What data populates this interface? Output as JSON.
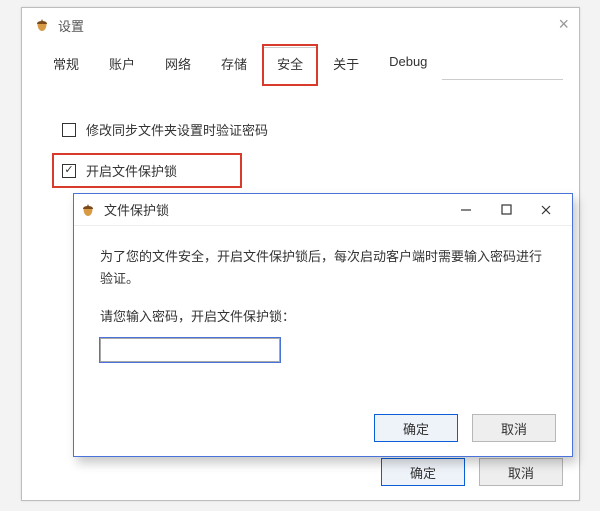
{
  "main": {
    "title": "设置",
    "tabs": [
      {
        "label": "常规"
      },
      {
        "label": "账户"
      },
      {
        "label": "网络"
      },
      {
        "label": "存储"
      },
      {
        "label": "安全",
        "active": true,
        "highlight": true
      },
      {
        "label": "关于"
      },
      {
        "label": "Debug"
      }
    ],
    "check1": {
      "label": "修改同步文件夹设置时验证密码",
      "checked": false
    },
    "check2": {
      "label": "开启文件保护锁",
      "checked": true
    },
    "ok_label": "确定",
    "cancel_label": "取消"
  },
  "dialog": {
    "title": "文件保护锁",
    "message": "为了您的文件安全，开启文件保护锁后，每次启动客户端时需要输入密码进行验证。",
    "prompt": "请您输入密码，开启文件保护锁：",
    "ok_label": "确定",
    "cancel_label": "取消",
    "input_value": ""
  },
  "icons": {
    "acorn": "acorn-icon",
    "close": "close-icon",
    "minimize": "minimize-icon",
    "maximize": "maximize-icon"
  },
  "colors": {
    "highlight_red": "#d83a2b",
    "dialog_border": "#4a73d9"
  }
}
